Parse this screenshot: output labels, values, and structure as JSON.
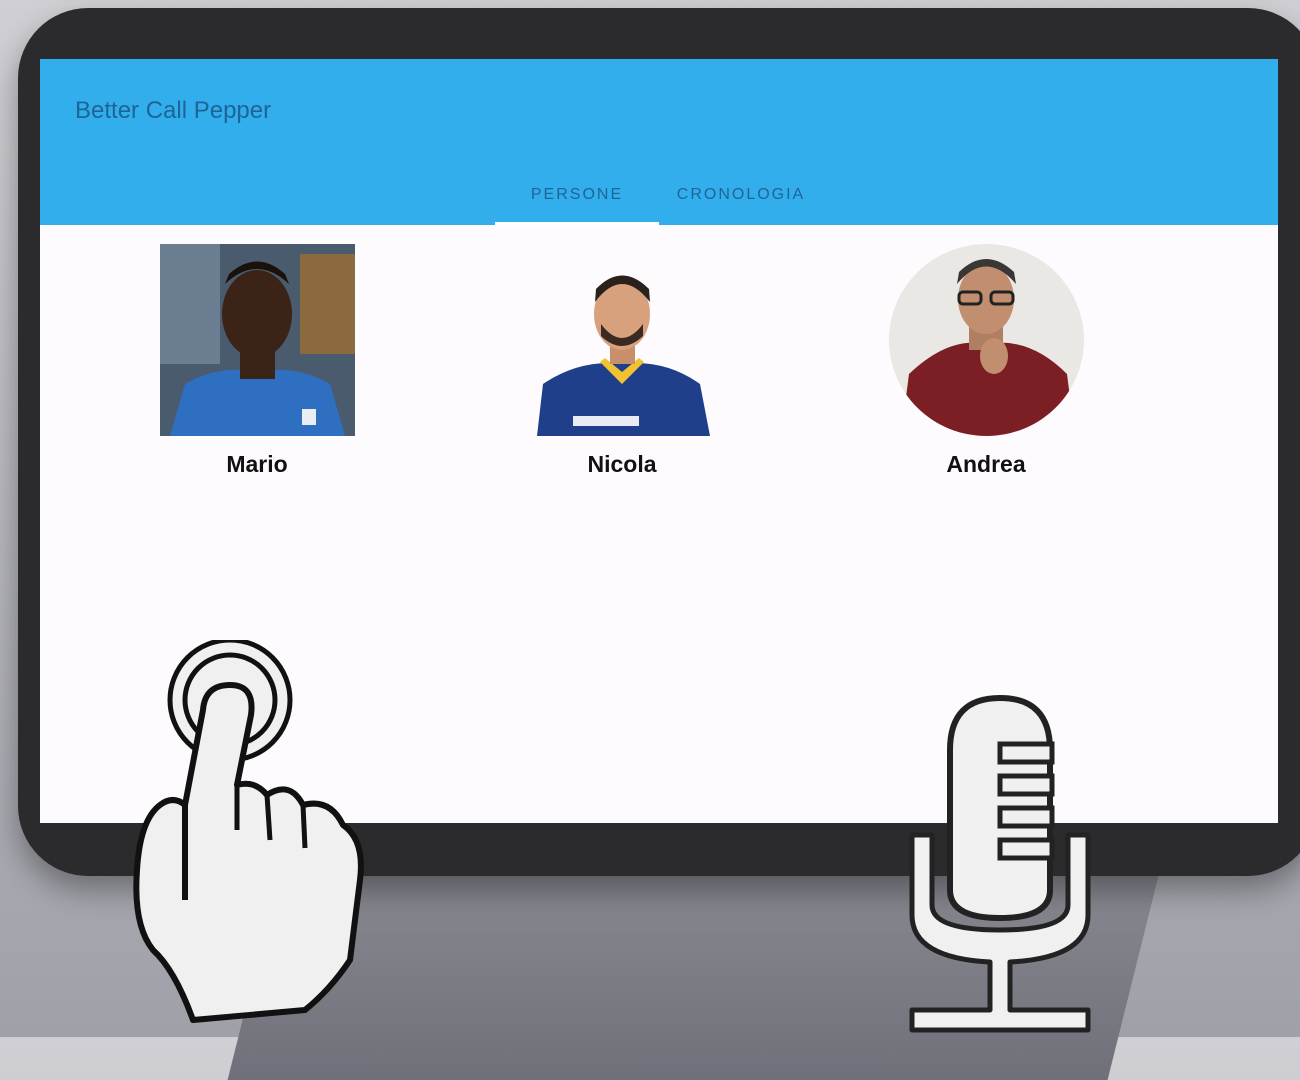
{
  "app": {
    "title": "Better Call Pepper"
  },
  "tabs": [
    {
      "label": "PERSONE",
      "active": true
    },
    {
      "label": "CRONOLOGIA",
      "active": false
    }
  ],
  "people": [
    {
      "name": "Mario"
    },
    {
      "name": "Nicola"
    },
    {
      "name": "Andrea"
    }
  ],
  "colors": {
    "appbar": "#33aeec",
    "title_text": "#1d6596",
    "screen_bg": "#fdfbfe",
    "device_frame": "#2b2b2e"
  },
  "overlay_icons": [
    "touch-hand-icon",
    "microphone-icon"
  ]
}
